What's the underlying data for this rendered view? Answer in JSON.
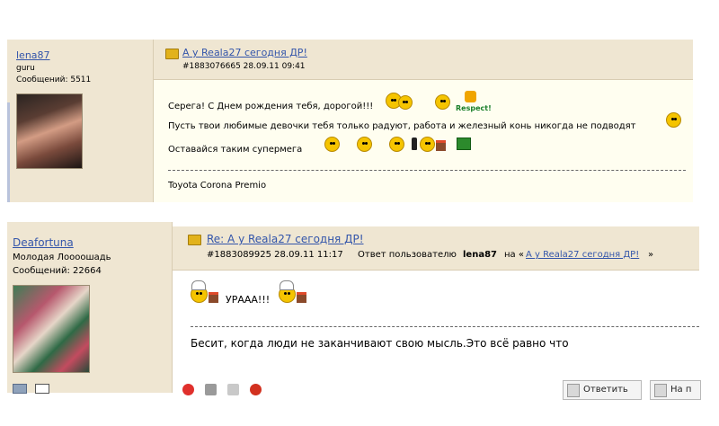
{
  "post1": {
    "username": "lena87",
    "rank": "guru",
    "messages_label": "Сообщений: 5511",
    "title": "А у Reala27 сегодня ДР!",
    "meta": "#1883076665 28.09.11 09:41",
    "line1": "Серега! С Днем рождения тебя, дорогой!!!",
    "line2": "Пусть твои любимые девочки тебя только радуют, работа и железный конь никогда не подводят",
    "line3": "Оставайся таким супермега",
    "respect": "Respect!",
    "signature": "Toyota Corona Premio"
  },
  "post2": {
    "username": "Deafortuna",
    "rank": "Молодая Лоооошадь",
    "messages_label": "Сообщений: 22664",
    "title": "Re: А у Reala27 сегодня ДР!",
    "meta": "#1883089925 28.09.11 11:17",
    "reply_prefix": "Ответ пользователю",
    "reply_user": "lena87",
    "reply_on": "на «",
    "reply_link": "А у Reala27 сегодня ДР!",
    "reply_end": "»",
    "message": "УРААА!!!",
    "signature": "Бесит, когда люди не заканчивают свою мысль.Это всё равно что",
    "reply_button": "Ответить",
    "next_button": "На п"
  }
}
